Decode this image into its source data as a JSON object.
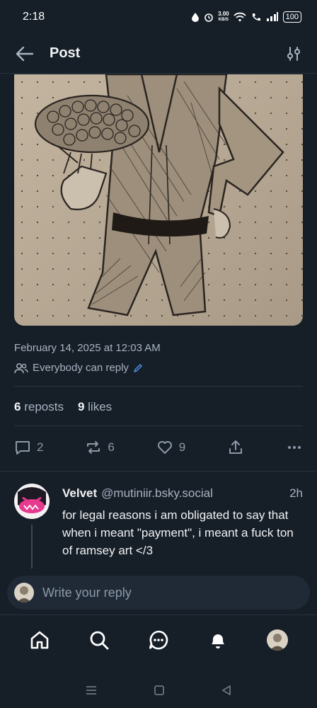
{
  "status_bar": {
    "time": "2:18",
    "net_speed_value": "3.00",
    "net_speed_unit": "KB/S",
    "battery": "100"
  },
  "header": {
    "back_icon": "arrow-left-icon",
    "title": "Post",
    "filter_icon": "sliders-icon"
  },
  "post": {
    "image_description_icon": "sketch-image",
    "date": "February 14, 2025 at 12:03 AM",
    "reply_setting": "Everybody can reply",
    "reposts_count": "6",
    "reposts_label": "reposts",
    "likes_count": "9",
    "likes_label": "likes",
    "actions": {
      "replies": "2",
      "reposts": "6",
      "likes": "9"
    }
  },
  "reply": {
    "display_name": "Velvet",
    "handle": "@mutiniir.bsky.social",
    "time": "2h",
    "text": "for legal reasons i am obligated to say that when i meant \"payment\", i meant a fuck ton of ramsey art </3"
  },
  "composer": {
    "placeholder": "Write your reply"
  },
  "tabbar": {
    "items": [
      "home-icon",
      "search-icon",
      "chat-icon",
      "bell-icon",
      "profile-avatar"
    ]
  },
  "colors": {
    "background": "#161e27",
    "accent": "#4a90e2",
    "muted": "#a8b4c2"
  }
}
